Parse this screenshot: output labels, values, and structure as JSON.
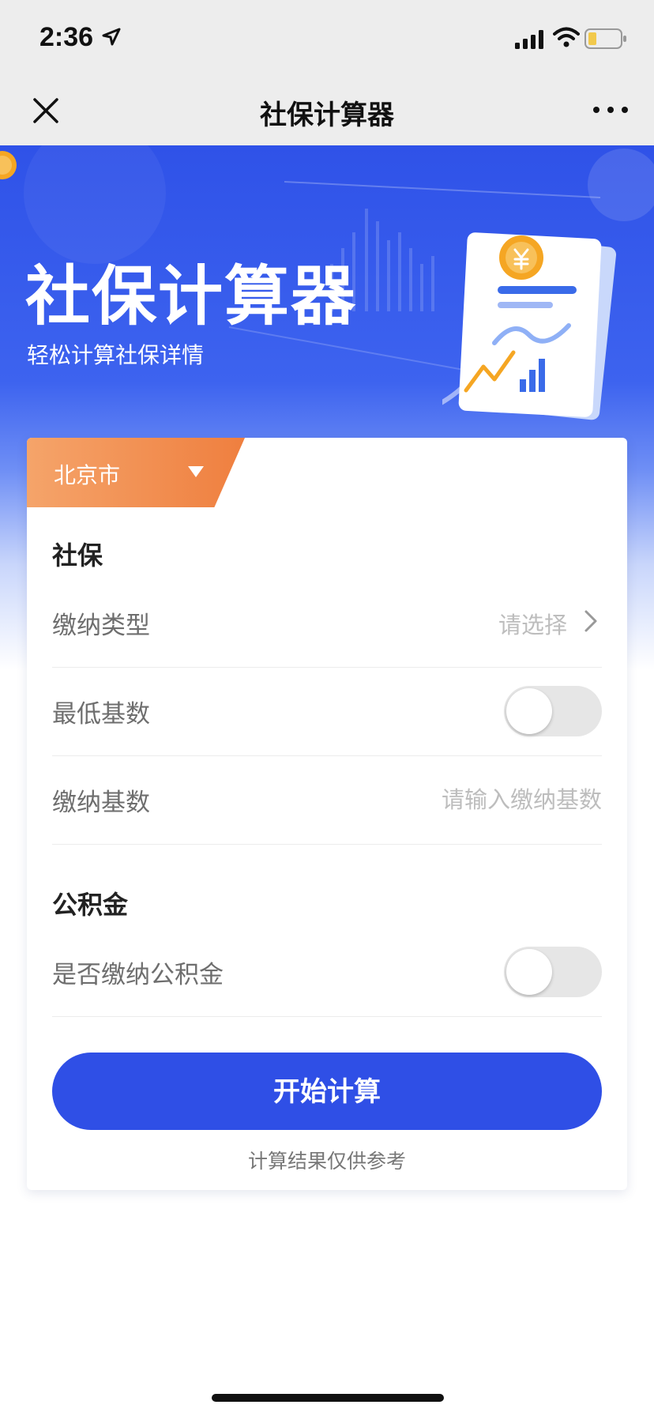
{
  "status_bar": {
    "time": "2:36",
    "location_icon": "location-arrow-icon",
    "signal_icon": "cellular-signal-icon",
    "wifi_icon": "wifi-icon",
    "battery_icon": "battery-low-icon"
  },
  "nav": {
    "title": "社保计算器",
    "close_icon": "close-icon",
    "more_icon": "more-dots-icon"
  },
  "banner": {
    "title": "社保计算器",
    "subtitle": "轻松计算社保详情",
    "illustration": "document-chart-coin-illustration"
  },
  "card": {
    "city": {
      "label": "北京市",
      "icon": "triangle-down-icon"
    },
    "social_security": {
      "title": "社保",
      "payment_type": {
        "label": "缴纳类型",
        "placeholder": "请选择",
        "icon": "chevron-right-icon"
      },
      "minimum_base": {
        "label": "最低基数",
        "enabled": false
      },
      "payment_base": {
        "label": "缴纳基数",
        "placeholder": "请输入缴纳基数",
        "value": ""
      }
    },
    "housing_fund": {
      "title": "公积金",
      "pay_fund": {
        "label": "是否缴纳公积金",
        "enabled": false
      }
    },
    "start_button": "开始计算",
    "disclaimer": "计算结果仅供参考"
  },
  "colors": {
    "primary": "#2f4fe6",
    "banner_top": "#2f52e8",
    "city_tab_start": "#f5a46a",
    "city_tab_end": "#ef7f3f",
    "toggle_off": "#e6e6e6"
  }
}
